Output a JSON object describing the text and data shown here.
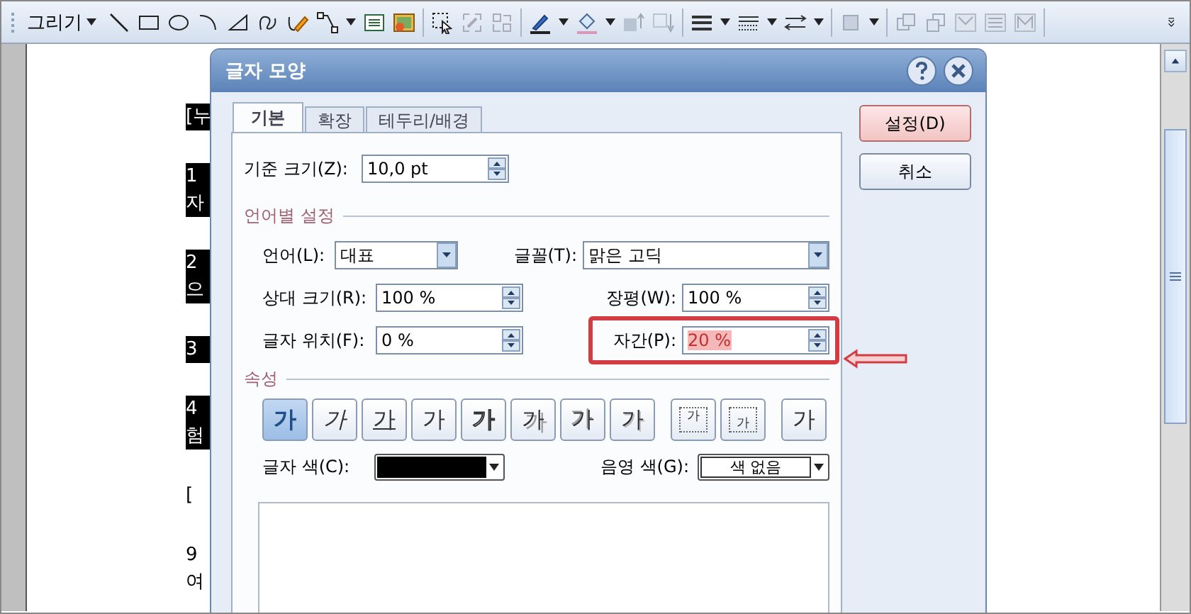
{
  "toolbar": {
    "menu_label": "그리기"
  },
  "document": {
    "paragraphs": [
      {
        "highlighted": true,
        "lines": [
          "[누"
        ]
      },
      {
        "highlighted": true,
        "lines": [
          "1",
          "자"
        ]
      },
      {
        "highlighted": true,
        "lines": [
          "2",
          "으"
        ]
      },
      {
        "highlighted": true,
        "lines": [
          "3"
        ]
      },
      {
        "highlighted": true,
        "lines": [
          "4",
          "험"
        ]
      },
      {
        "highlighted": false,
        "lines": [
          "["
        ]
      },
      {
        "highlighted": false,
        "lines": [
          "9",
          "여"
        ]
      }
    ]
  },
  "dialog": {
    "title": "글자 모양",
    "tabs": [
      {
        "label": "기본",
        "selected": true
      },
      {
        "label": "확장",
        "selected": false
      },
      {
        "label": "테두리/배경",
        "selected": false
      }
    ],
    "buttons": [
      {
        "label": "설정(D)",
        "default": true
      },
      {
        "label": "취소",
        "default": false
      }
    ],
    "base_size": {
      "label": "기준 크기(Z):",
      "value": "10,0 pt"
    },
    "language_section": {
      "title": "언어별 설정",
      "language": {
        "label": "언어(L):",
        "value": "대표"
      },
      "font": {
        "label": "글꼴(T):",
        "value": "맑은 고딕"
      },
      "relative_size": {
        "label": "상대 크기(R):",
        "value": "100 %"
      },
      "width_ratio": {
        "label": "장평(W):",
        "value": "100 %"
      },
      "position": {
        "label": "글자 위치(F):",
        "value": "0 %"
      },
      "spacing": {
        "label": "자간(P):",
        "value": "20 %",
        "highlighted": true
      }
    },
    "attributes_section": {
      "title": "속성",
      "buttons": [
        {
          "label": "가",
          "kind": "bold",
          "selected": true
        },
        {
          "label": "가",
          "kind": "italic",
          "selected": false
        },
        {
          "label": "가",
          "kind": "underline",
          "selected": false
        },
        {
          "label": "가",
          "kind": "strike",
          "selected": false
        },
        {
          "label": "가",
          "kind": "outline",
          "selected": false
        },
        {
          "label": "가",
          "kind": "shadow",
          "selected": false
        },
        {
          "label": "가",
          "kind": "emboss",
          "selected": false
        },
        {
          "label": "가",
          "kind": "engrave",
          "selected": false
        },
        {
          "label": "가",
          "kind": "superscript",
          "selected": false
        },
        {
          "label": "가",
          "kind": "subscript",
          "selected": false
        },
        {
          "label": "가",
          "kind": "normal",
          "selected": false
        }
      ]
    },
    "text_color": {
      "label": "글자 색(C):",
      "color": "#000000"
    },
    "shade_color": {
      "label": "음영 색(G):",
      "value": "색 없음"
    }
  }
}
